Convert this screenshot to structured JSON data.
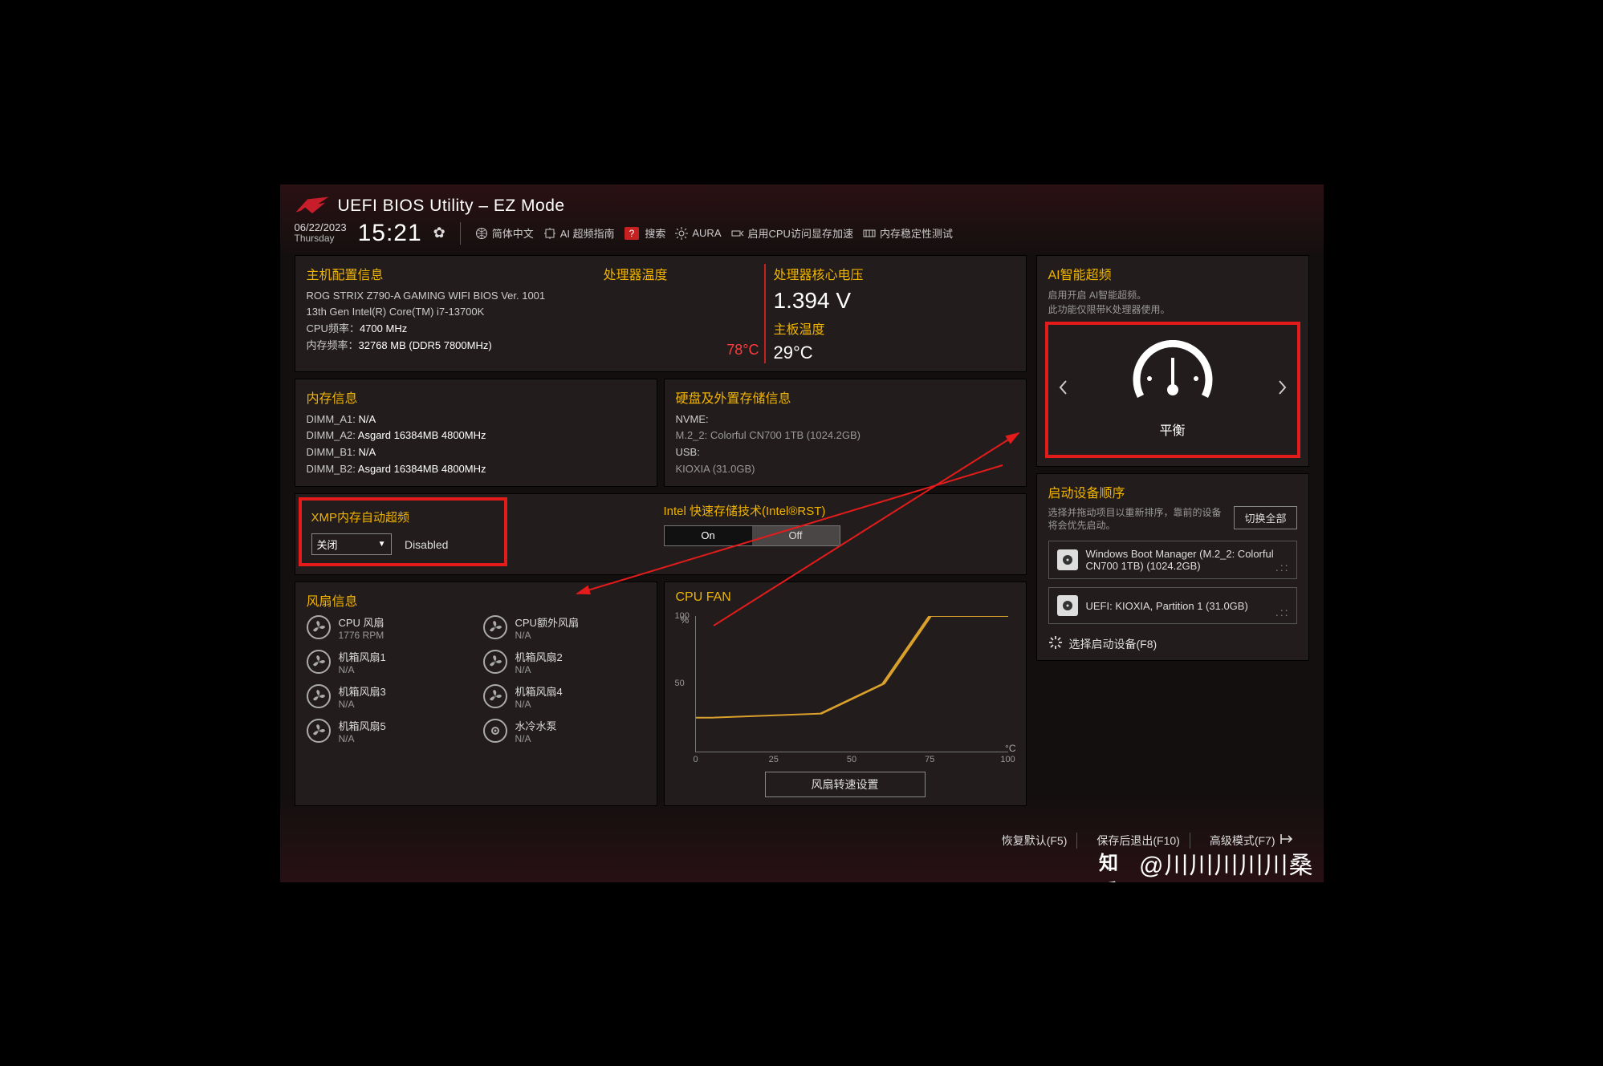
{
  "header": {
    "title": "UEFI BIOS Utility – EZ Mode",
    "date": "06/22/2023",
    "day": "Thursday",
    "time": "15:21",
    "lang": "简体中文",
    "ai_guide": "AI 超频指南",
    "search": "搜索",
    "aura": "AURA",
    "cpu_mem_accel": "启用CPU访问显存加速",
    "mem_stability": "内存稳定性测试"
  },
  "sysinfo": {
    "title": "主机配置信息",
    "board": "ROG STRIX Z790-A GAMING WIFI    BIOS Ver. 1001",
    "cpu": "13th Gen Intel(R) Core(TM) i7-13700K",
    "cpu_freq_label": "CPU频率：",
    "cpu_freq": "4700 MHz",
    "mem_freq_label": "内存频率：",
    "mem_freq": "32768 MB (DDR5 7800MHz)"
  },
  "cpu_temp": {
    "title": "处理器温度",
    "value": "78°C"
  },
  "vcore": {
    "title": "处理器核心电压",
    "value": "1.394 V",
    "mb_temp_title": "主板温度",
    "mb_temp": "29°C"
  },
  "meminfo": {
    "title": "内存信息",
    "slots": [
      {
        "slot": "DIMM_A1",
        "val": "N/A"
      },
      {
        "slot": "DIMM_A2",
        "val": "Asgard 16384MB 4800MHz"
      },
      {
        "slot": "DIMM_B1",
        "val": "N/A"
      },
      {
        "slot": "DIMM_B2",
        "val": "Asgard 16384MB 4800MHz"
      }
    ]
  },
  "storage": {
    "title": "硬盘及外置存储信息",
    "nvme_label": "NVME:",
    "nvme": "M.2_2: Colorful CN700 1TB (1024.2GB)",
    "usb_label": "USB:",
    "usb": "KIOXIA (31.0GB)"
  },
  "xmp": {
    "title": "XMP内存自动超频",
    "value": "关闭",
    "status": "Disabled"
  },
  "rst": {
    "title": "Intel 快速存储技术(Intel®RST)",
    "on": "On",
    "off": "Off"
  },
  "fans": {
    "title": "风扇信息",
    "items": [
      {
        "name": "CPU 风扇",
        "val": "1776 RPM"
      },
      {
        "name": "CPU额外风扇",
        "val": "N/A"
      },
      {
        "name": "机箱风扇1",
        "val": "N/A"
      },
      {
        "name": "机箱风扇2",
        "val": "N/A"
      },
      {
        "name": "机箱风扇3",
        "val": "N/A"
      },
      {
        "name": "机箱风扇4",
        "val": "N/A"
      },
      {
        "name": "机箱风扇5",
        "val": "N/A"
      },
      {
        "name": "水冷水泵",
        "val": "N/A"
      }
    ]
  },
  "cpu_fan": {
    "title": "CPU FAN",
    "y_unit": "%",
    "x_unit": "°C",
    "button": "风扇转速设置"
  },
  "chart_data": {
    "type": "line",
    "title": "CPU FAN",
    "xlabel": "°C",
    "ylabel": "%",
    "xlim": [
      0,
      100
    ],
    "ylim": [
      0,
      100
    ],
    "x_ticks": [
      0,
      25,
      50,
      75,
      100
    ],
    "y_ticks": [
      50,
      100
    ],
    "x": [
      0,
      5,
      40,
      60,
      75,
      100
    ],
    "values": [
      25,
      25,
      28,
      50,
      100,
      100
    ]
  },
  "ai": {
    "title": "AI智能超频",
    "desc1": "启用开启 AI智能超频。",
    "desc2": "此功能仅限带K处理器使用。",
    "mode": "平衡"
  },
  "boot": {
    "title": "启动设备顺序",
    "desc": "选择并拖动项目以重新排序，靠前的设备将会优先启动。",
    "swap": "切换全部",
    "items": [
      "Windows Boot Manager (M.2_2: Colorful CN700 1TB) (1024.2GB)",
      "UEFI: KIOXIA, Partition 1 (31.0GB)"
    ],
    "choose": "选择启动设备(F8)"
  },
  "footer": {
    "defaults": "恢复默认(F5)",
    "save_exit": "保存后退出(F10)",
    "advanced": "高级模式(F7)"
  },
  "watermark": "@川川川川川桑",
  "watermark_site": "知乎"
}
